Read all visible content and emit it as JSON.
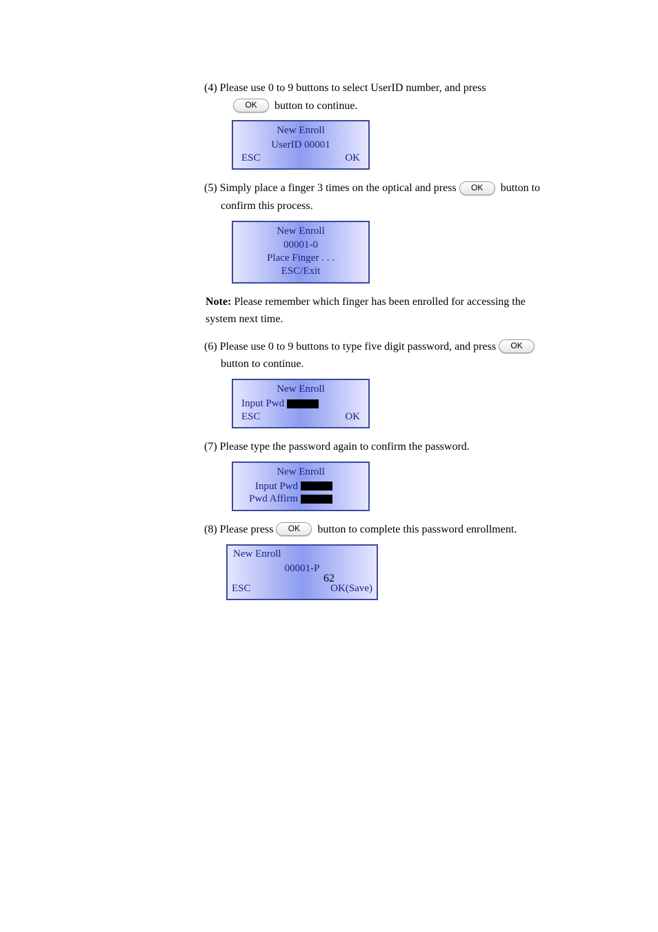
{
  "ok_label": "OK",
  "step4": {
    "line1": "(4) Please use 0 to 9 buttons to select UserID number, and press",
    "line2_after_ok": " button to continue."
  },
  "lcd4": {
    "title": "New Enroll",
    "userid_line": "UserID  00001",
    "esc": "ESC",
    "ok": "OK"
  },
  "step5": {
    "line1_before_ok": "(5) Simply place a finger 3 times on the optical and press ",
    "line1_after_ok": " button to",
    "line2": "confirm this process."
  },
  "lcd5": {
    "title": "New Enroll",
    "sub": "00001-0",
    "place": "Place Finger .   .   .",
    "exit": "ESC/Exit"
  },
  "note_text_strong": "Note:",
  "note_text_rest": " Please remember which finger has been enrolled for accessing the system next time.",
  "step6": {
    "line1_before_ok": "(6) Please use 0 to 9 buttons to type five digit password, and press ",
    "line2": "button to continue."
  },
  "lcd6": {
    "title": "New Enroll",
    "input_label": "Input  Pwd",
    "esc": "ESC",
    "ok": "OK"
  },
  "step7": {
    "line1": "(7) Please type the password again to confirm the password."
  },
  "lcd7": {
    "title": "New Enroll",
    "input_label": "Input  Pwd",
    "affirm_label": "Pwd  Affirm"
  },
  "step8": {
    "before_ok": "(8) Please press ",
    "after_ok": " button to complete this password enrollment."
  },
  "lcd8": {
    "title": "New Enroll",
    "sub": "00001-P",
    "esc": "ESC",
    "ok": "OK(Save)"
  },
  "page_number": "62"
}
